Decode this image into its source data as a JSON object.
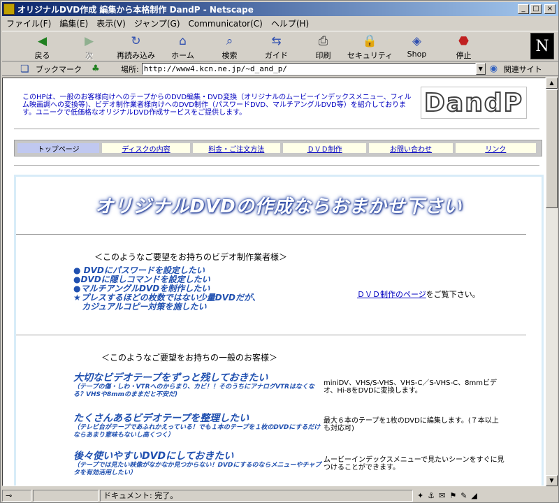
{
  "window": {
    "title": "オリジナルDVD作成 編集から本格制作 DandP - Netscape",
    "buttons": {
      "minimize": "_",
      "maximize": "□",
      "close": "×"
    }
  },
  "menu": [
    "ファイル(F)",
    "編集(E)",
    "表示(V)",
    "ジャンプ(G)",
    "Communicator(C)",
    "ヘルプ(H)"
  ],
  "toolbar": {
    "items": [
      {
        "label": "戻る",
        "icon": "back-arrow-icon",
        "glyph": "◀"
      },
      {
        "label": "次",
        "icon": "forward-arrow-icon",
        "glyph": "▶"
      },
      {
        "label": "再読み込み",
        "icon": "reload-icon",
        "glyph": "↻"
      },
      {
        "label": "ホーム",
        "icon": "home-icon",
        "glyph": "⌂"
      },
      {
        "label": "検索",
        "icon": "search-icon",
        "glyph": "⌕"
      },
      {
        "label": "ガイド",
        "icon": "guide-icon",
        "glyph": "⇆"
      },
      {
        "label": "印刷",
        "icon": "print-icon",
        "glyph": "⎙"
      },
      {
        "label": "セキュリティ",
        "icon": "lock-icon",
        "glyph": "🔒"
      },
      {
        "label": "Shop",
        "icon": "shop-icon",
        "glyph": "◈"
      },
      {
        "label": "停止",
        "icon": "stop-icon",
        "glyph": "⬣"
      }
    ],
    "logo": "N"
  },
  "location": {
    "bookmark_label": "ブックマーク",
    "location_label": "場所:",
    "url": "http://www4.kcn.ne.jp/~d_and_p/",
    "related_label": "関連サイト"
  },
  "page": {
    "intro": "このHPは、一般のお客様向けへのテープからのDVD編集・DVD変換（オリジナルのムービーインデックスメニュー、フィルム映画調への変換等)、ビデオ制作業者様向けへのDVD制作（パスワードDVD、マルチアングルDVD等）を紹介しております。ユニークで低価格なオリジナルDVD作成サービスをご提供します。",
    "logo_text": "DandP",
    "nav": [
      {
        "label": "トップページ",
        "active": true,
        "w": 118
      },
      {
        "label": "ディスクの内容",
        "active": false,
        "w": 126
      },
      {
        "label": "料金・ご注文方法",
        "active": false,
        "w": 126
      },
      {
        "label": "ＤＶＤ制作",
        "active": false,
        "w": 120
      },
      {
        "label": "お問い合わせ",
        "active": false,
        "w": 120
      },
      {
        "label": "リンク",
        "active": false,
        "w": 116
      }
    ],
    "headline": "オリジナルDVDの作成ならおまかせ下さい",
    "pro_section": {
      "title": "＜このようなご要望をお持ちのビデオ制作業者様＞",
      "bullets": [
        "● DVDにパスワードを設定したい",
        "●DVDに隠しコマンドを設定したい",
        "●マルチアングルDVDを制作したい",
        "★プレスするほどの枚数ではない少量DVDだが、",
        "　カジュアルコピー対策を施したい"
      ],
      "link": "ＤＶＤ制作のページ",
      "link_suffix": "をご覧下さい。"
    },
    "consumer_section": {
      "title": "＜このようなご要望をお持ちの一般のお客様＞",
      "items": [
        {
          "title": "大切なビデオテープをずっと残しておきたい",
          "sub": "（テープの傷・しわ・VTRへのからまり、カビ！！そのうちにアナログVTRはなくなる？VHSや8mmのままだと不安だ)",
          "answer": "miniDV、VHS/S-VHS、VHS-C／S-VHS-C、8mmビデオ、Hi-8をDVDに変換します。"
        },
        {
          "title": "たくさんあるビデオテープを整理したい",
          "sub": "（テレビ台がテープであふれかえっている！でも１本のテープを１枚のDVDにするだけならあまり意味もないし高くつく）",
          "answer": "最大６本のテープを1枚のDVDに編集します。(７本以上も対応可)"
        },
        {
          "title": "後々使いやすいDVDにしておきたい",
          "sub": "（テープでは見たい映像がなかなか見つからない！DVDにするのならメニューやチャプタを有効活用したい）",
          "answer": "ムービーインデックスメニューで見たいシーンをすぐに見つけることができます。"
        }
      ]
    }
  },
  "status": {
    "text": "ドキュメント: 完了。"
  }
}
